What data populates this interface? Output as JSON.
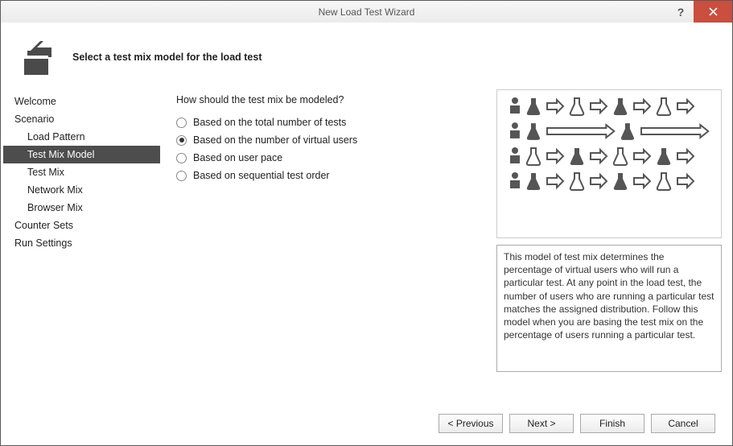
{
  "window": {
    "title": "New Load Test Wizard",
    "subtitle": "Select a test mix model for the load test"
  },
  "sidebar": {
    "items": [
      {
        "label": "Welcome",
        "indent": false,
        "selected": false
      },
      {
        "label": "Scenario",
        "indent": false,
        "selected": false
      },
      {
        "label": "Load Pattern",
        "indent": true,
        "selected": false
      },
      {
        "label": "Test Mix Model",
        "indent": true,
        "selected": true
      },
      {
        "label": "Test Mix",
        "indent": true,
        "selected": false
      },
      {
        "label": "Network Mix",
        "indent": true,
        "selected": false
      },
      {
        "label": "Browser Mix",
        "indent": true,
        "selected": false
      },
      {
        "label": "Counter Sets",
        "indent": false,
        "selected": false
      },
      {
        "label": "Run Settings",
        "indent": false,
        "selected": false
      }
    ]
  },
  "options": {
    "question": "How should the test mix be modeled?",
    "items": [
      {
        "label": "Based on the total number of tests",
        "selected": false
      },
      {
        "label": "Based on the number of virtual users",
        "selected": true
      },
      {
        "label": "Based on user pace",
        "selected": false
      },
      {
        "label": "Based on sequential test order",
        "selected": false
      }
    ]
  },
  "description": "This model of test mix determines the percentage of virtual users who will run a particular test. At any point in the load test, the number of users who are running a particular test matches the assigned distribution. Follow this model when you are basing the test mix on the percentage of users running a particular test.",
  "buttons": {
    "previous": "< Previous",
    "next": "Next >",
    "finish": "Finish",
    "cancel": "Cancel"
  },
  "illustration": {
    "rows": [
      {
        "pattern": [
          "filled",
          "arrow",
          "outline",
          "arrow",
          "filled",
          "arrow",
          "outline",
          "arrow"
        ]
      },
      {
        "pattern": [
          "filled",
          "long-arrow",
          "filled",
          "long-arrow"
        ]
      },
      {
        "pattern": [
          "outline",
          "arrow",
          "filled",
          "arrow",
          "outline",
          "arrow",
          "filled",
          "arrow"
        ]
      },
      {
        "pattern": [
          "filled",
          "arrow",
          "outline",
          "arrow",
          "filled",
          "arrow",
          "outline",
          "arrow"
        ]
      }
    ]
  }
}
